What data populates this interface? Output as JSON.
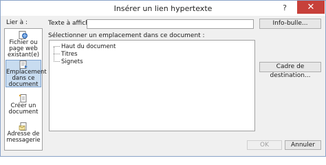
{
  "window": {
    "title": "Insérer un lien hypertexte",
    "help_glyph": "?",
    "close_glyph": "✕"
  },
  "sidebar": {
    "heading": "Lier à :",
    "items": [
      {
        "lines": [
          "Fichier ou",
          "page web",
          "existant(e)"
        ],
        "icon": "web-page-icon",
        "selected": false
      },
      {
        "lines": [
          "Emplacement",
          "dans ce",
          "document"
        ],
        "icon": "document-place-icon",
        "selected": true
      },
      {
        "lines": [
          "Créer un",
          "document"
        ],
        "icon": "new-document-icon",
        "selected": false
      },
      {
        "lines": [
          "Adresse de",
          "messagerie"
        ],
        "icon": "email-icon",
        "selected": false
      }
    ]
  },
  "form": {
    "text_to_display_label": "Texte à afficher :",
    "text_to_display_value": "",
    "screentip_button": "Info-bulle...",
    "location_label": "Sélectionner un emplacement dans ce document :",
    "tree": [
      "Haut du document",
      "Titres",
      "Signets"
    ],
    "target_frame_button": "Cadre de destination..."
  },
  "footer": {
    "ok_button": "OK",
    "cancel_button": "Annuler"
  },
  "colors": {
    "close_button": "#c7403a",
    "selected_item_bg": "#c8dcf0"
  }
}
